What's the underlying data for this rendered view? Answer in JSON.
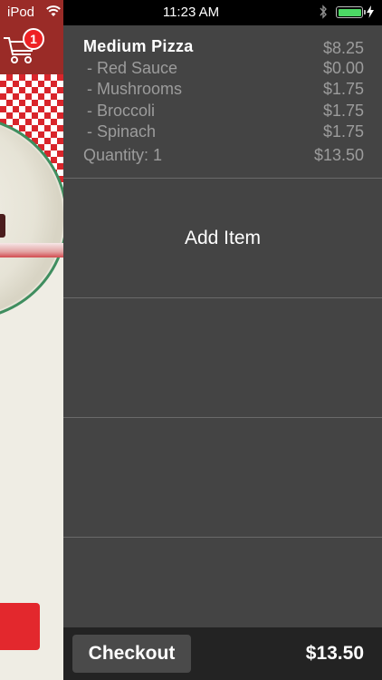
{
  "status_bar": {
    "carrier": "iPod",
    "time": "11:23 AM",
    "battery_level": 1.0,
    "icons": [
      "wifi-icon",
      "bluetooth-icon",
      "battery-icon",
      "charging-icon"
    ]
  },
  "cart": {
    "icon": "cart-icon",
    "badge_count": "1"
  },
  "order": {
    "item_name": "Medium  Pizza",
    "item_price": "$8.25",
    "options": [
      {
        "label": "- Red Sauce",
        "price": "$0.00"
      },
      {
        "label": "- Mushrooms",
        "price": "$1.75"
      },
      {
        "label": "- Broccoli",
        "price": "$1.75"
      },
      {
        "label": "- Spinach",
        "price": "$1.75"
      }
    ],
    "quantity_label": "Quantity: 1",
    "line_total": "$13.50"
  },
  "add_item_label": "Add Item",
  "footer": {
    "checkout_label": "Checkout",
    "total": "$13.50"
  },
  "colors": {
    "drawer_bg": "#444444",
    "footer_bg": "#232323",
    "header_red": "#9a2b27",
    "badge_red": "#ee2124",
    "battery_green": "#4cd964",
    "muted_text": "#9c9c9c"
  }
}
